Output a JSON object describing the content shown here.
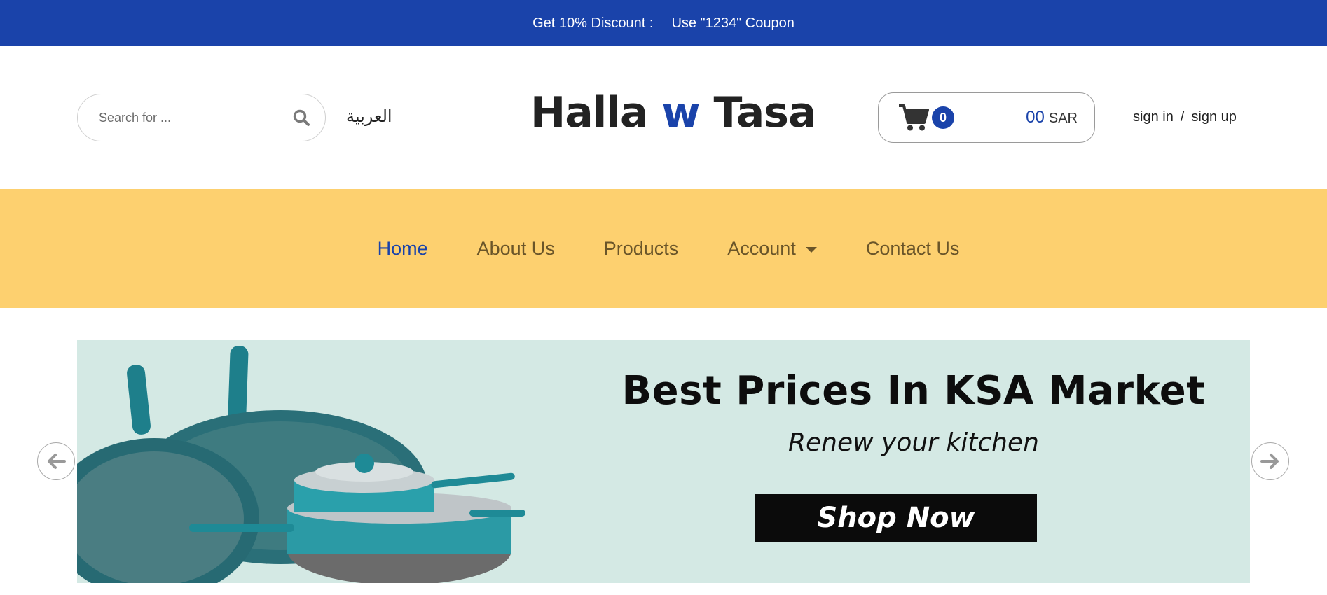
{
  "promo": {
    "label": "Get 10% Discount :",
    "coupon": "Use \"1234\" Coupon"
  },
  "header": {
    "search_placeholder": "Search for ...",
    "language_link": "العربية",
    "logo": {
      "part1": "Halla",
      "part2": "w",
      "part3": "Tasa"
    },
    "cart": {
      "count": "0",
      "amount": "00",
      "currency": "SAR"
    },
    "auth": {
      "sign_in": "sign in",
      "separator": "/",
      "sign_up": "sign up"
    }
  },
  "nav": {
    "items": [
      {
        "label": "Home",
        "active": true
      },
      {
        "label": "About Us"
      },
      {
        "label": "Products"
      },
      {
        "label": "Account"
      },
      {
        "label": "Contact Us"
      }
    ]
  },
  "hero": {
    "title": "Best Prices In KSA Market",
    "subtitle": "Renew your kitchen",
    "cta": "Shop Now"
  },
  "colors": {
    "primary": "#1a43aa",
    "nav_bg": "#fdd06f",
    "hero_bg": "#d4e9e4",
    "pan_teal": "#1f8a96"
  },
  "icons": {
    "search": "search-icon",
    "cart": "cart-icon",
    "prev": "arrow-left-icon",
    "next": "arrow-right-icon",
    "dropdown": "caret-down-icon"
  }
}
